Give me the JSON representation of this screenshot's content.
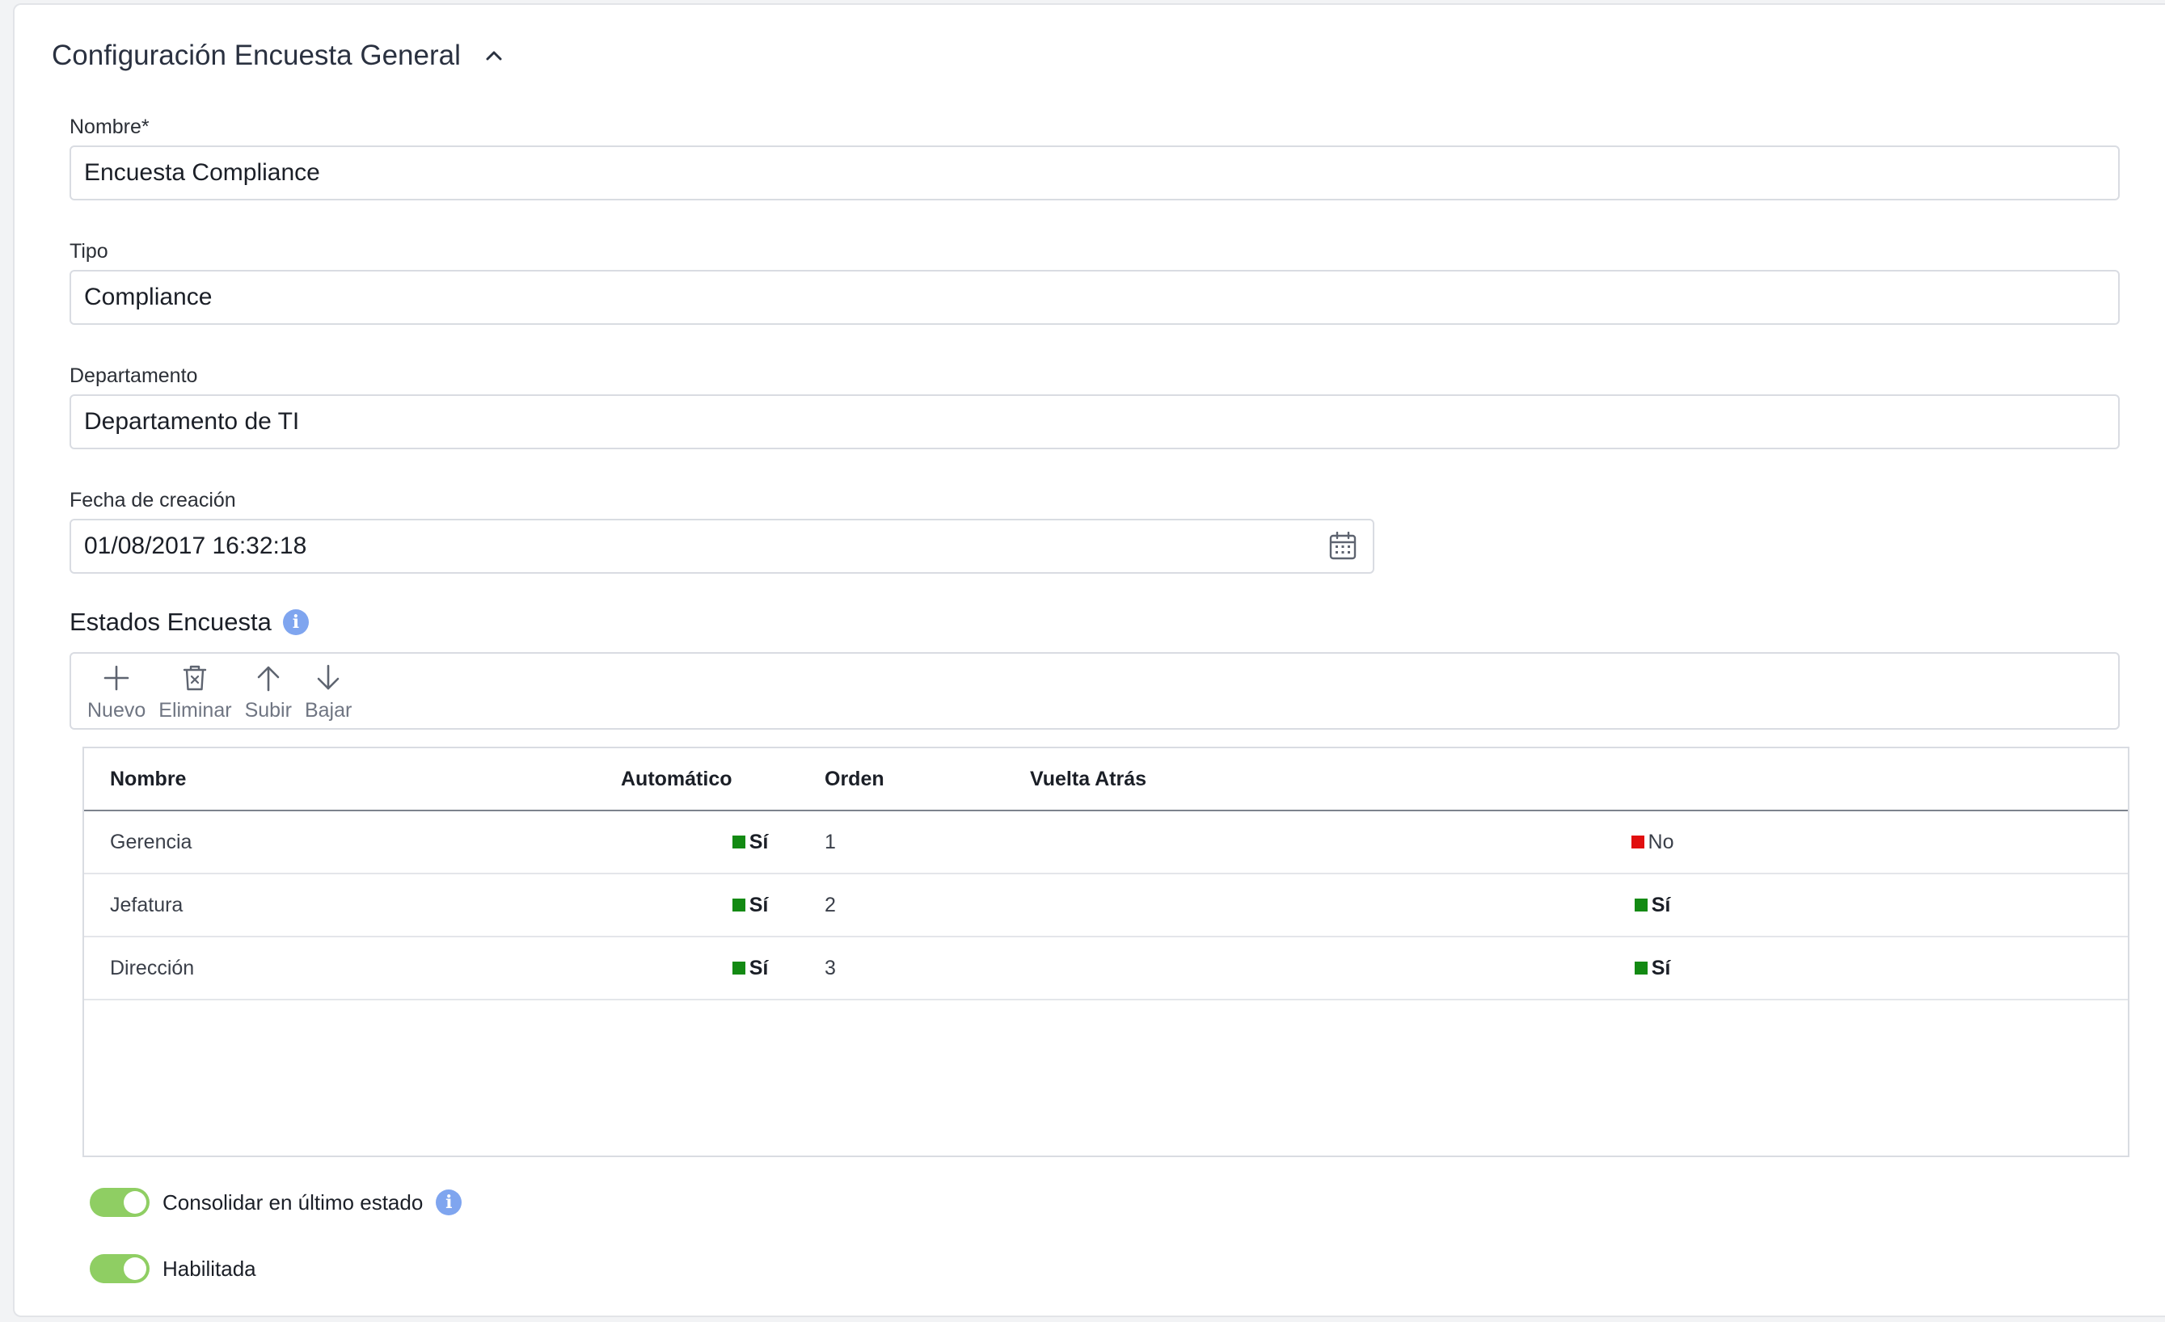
{
  "section": {
    "title": "Configuración Encuesta General"
  },
  "fields": {
    "nombre": {
      "label": "Nombre*",
      "value": "Encuesta Compliance"
    },
    "tipo": {
      "label": "Tipo",
      "value": "Compliance"
    },
    "departamento": {
      "label": "Departamento",
      "value": "Departamento de TI"
    },
    "fecha": {
      "label": "Fecha de creación",
      "value": "01/08/2017 16:32:18"
    }
  },
  "estados": {
    "title": "Estados Encuesta",
    "toolbar": {
      "nuevo": "Nuevo",
      "eliminar": "Eliminar",
      "subir": "Subir",
      "bajar": "Bajar"
    },
    "columns": {
      "nombre": "Nombre",
      "automatico": "Automático",
      "orden": "Orden",
      "vuelta": "Vuelta Atrás"
    },
    "rows": [
      {
        "nombre": "Gerencia",
        "automatico": "Sí",
        "orden": "1",
        "extra": "No"
      },
      {
        "nombre": "Jefatura",
        "automatico": "Sí",
        "orden": "2",
        "extra": "Sí"
      },
      {
        "nombre": "Dirección",
        "automatico": "Sí",
        "orden": "3",
        "extra": "Sí"
      }
    ]
  },
  "toggles": {
    "consolidar": {
      "label": "Consolidar en último estado",
      "on": true
    },
    "habilitada": {
      "label": "Habilitada",
      "on": true
    }
  },
  "colors": {
    "yes": "#138a13",
    "no": "#e10f0f",
    "toggle_on": "#8fce63",
    "info": "#7fa5ef"
  },
  "icons": {
    "collapse": "chevron-up-icon",
    "date": "calendar-icon",
    "info": "info-icon",
    "nuevo": "plus-icon",
    "eliminar": "trash-icon",
    "subir": "arrow-up-icon",
    "bajar": "arrow-down-icon"
  }
}
